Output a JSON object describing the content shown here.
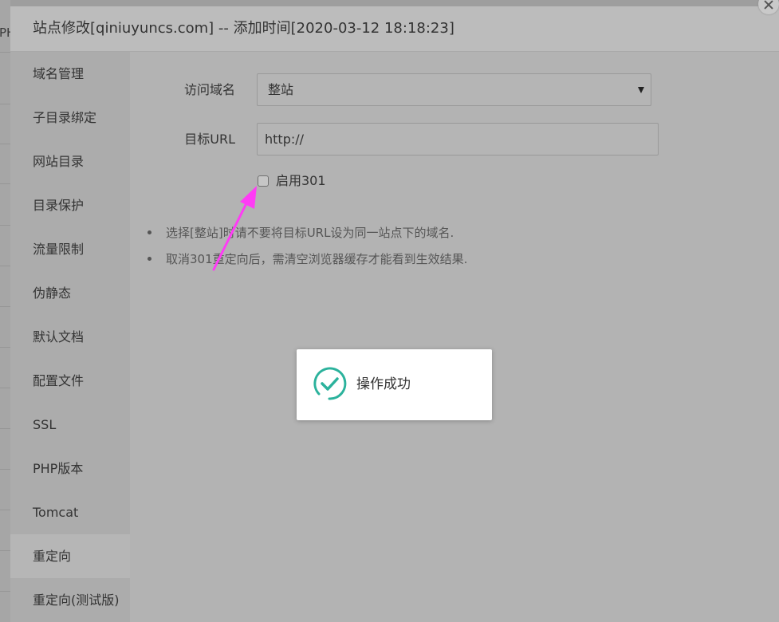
{
  "background_page": {
    "partial_text": "PH"
  },
  "modal": {
    "title": "站点修改[qiniuyuncs.com] -- 添加时间[2020-03-12 18:18:23]",
    "close_icon": "close-icon"
  },
  "sidebar": {
    "items": [
      {
        "label": "域名管理",
        "active": false
      },
      {
        "label": "子目录绑定",
        "active": false
      },
      {
        "label": "网站目录",
        "active": false
      },
      {
        "label": "目录保护",
        "active": false
      },
      {
        "label": "流量限制",
        "active": false
      },
      {
        "label": "伪静态",
        "active": false
      },
      {
        "label": "默认文档",
        "active": false
      },
      {
        "label": "配置文件",
        "active": false
      },
      {
        "label": "SSL",
        "active": false
      },
      {
        "label": "PHP版本",
        "active": false
      },
      {
        "label": "Tomcat",
        "active": false
      },
      {
        "label": "重定向",
        "active": true
      },
      {
        "label": "重定向(测试版)",
        "active": false
      }
    ]
  },
  "form": {
    "domain_label": "访问域名",
    "domain_value": "整站",
    "domain_caret_icon": "caret-down-icon",
    "target_label": "目标URL",
    "target_value": "http://",
    "enable301_label": "启用301",
    "enable301_checked": false
  },
  "notes": [
    "选择[整站]时请不要将目标URL设为同一站点下的域名.",
    "取消301重定向后，需清空浏览器缓存才能看到生效结果."
  ],
  "toast": {
    "icon": "check-circle-icon",
    "message": "操作成功"
  },
  "colors": {
    "toast_icon": "#2bb29c",
    "annotation_arrow": "#ff3cf5"
  }
}
